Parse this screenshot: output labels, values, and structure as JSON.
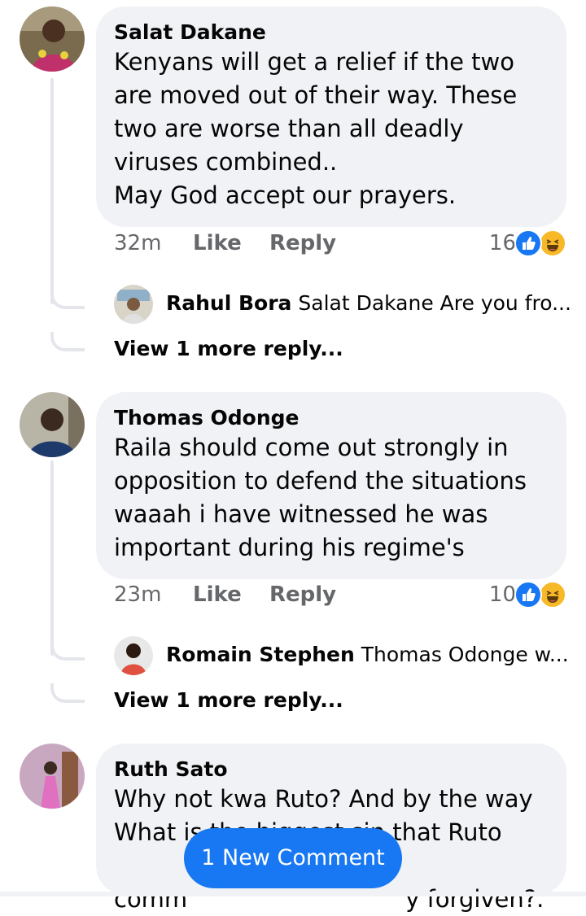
{
  "comments": [
    {
      "author": "Salat Dakane",
      "text": "Kenyans will get a relief if the two\nare moved out of their way. These\ntwo are worse than all deadly\nviruses combined..\nMay God accept our prayers.",
      "time": "32m",
      "like_label": "Like",
      "reply_label": "Reply",
      "reaction_count": "16",
      "reply_preview": {
        "author": "Rahul Bora",
        "text": "Salat Dakane Are you fro..."
      },
      "view_more": "View 1 more reply..."
    },
    {
      "author": "Thomas Odonge",
      "text": "Raila  should come out strongly  in\nopposition  to defend the situations\nwaaah i have witnessed  he was\nimportant  during his regime's",
      "time": "23m",
      "like_label": "Like",
      "reply_label": "Reply",
      "reaction_count": "10",
      "reply_preview": {
        "author": "Romain Stephen",
        "text": "Thomas Odonge w..."
      },
      "view_more": "View 1 more reply..."
    },
    {
      "author": "Ruth Sato",
      "text_line1": "Why not kwa Ruto? And by the way",
      "text_line2": "What is the biggest sin that Ruto",
      "text_line3_left": "comm",
      "text_line3_right": "y forgiven?."
    }
  ],
  "new_comment_pill": "1 New Comment",
  "icons": {
    "like_reaction": "like-reaction-icon",
    "haha_reaction": "haha-reaction-icon"
  },
  "colors": {
    "accent": "#1877f2",
    "bubble": "#f0f2f5",
    "meta": "#65676b",
    "haha": "#f7b928"
  }
}
